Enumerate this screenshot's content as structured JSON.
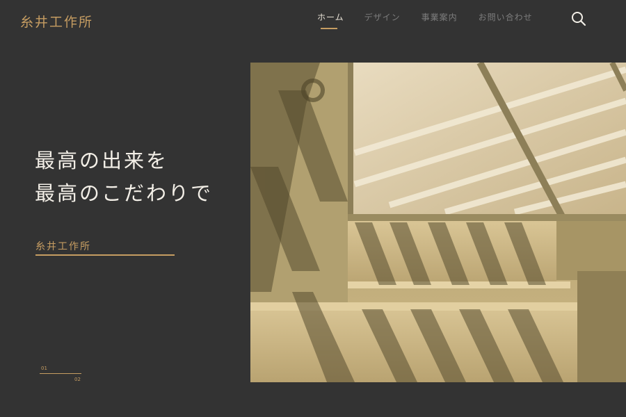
{
  "site": {
    "logo": "糸井工作所"
  },
  "nav": {
    "items": [
      {
        "label": "ホーム",
        "active": true
      },
      {
        "label": "デザイン",
        "active": false
      },
      {
        "label": "事業案内",
        "active": false
      },
      {
        "label": "お問い合わせ",
        "active": false
      }
    ],
    "search_icon": "search-icon"
  },
  "hero": {
    "line1": "最高の出来を",
    "line2": "最高のこだわりで",
    "company": "糸井工作所"
  },
  "pager": {
    "current": "01",
    "total": "02"
  },
  "colors": {
    "background": "#333333",
    "accent": "#c69d62",
    "text": "#f3efe7",
    "nav_inactive": "#7d7d7d"
  }
}
